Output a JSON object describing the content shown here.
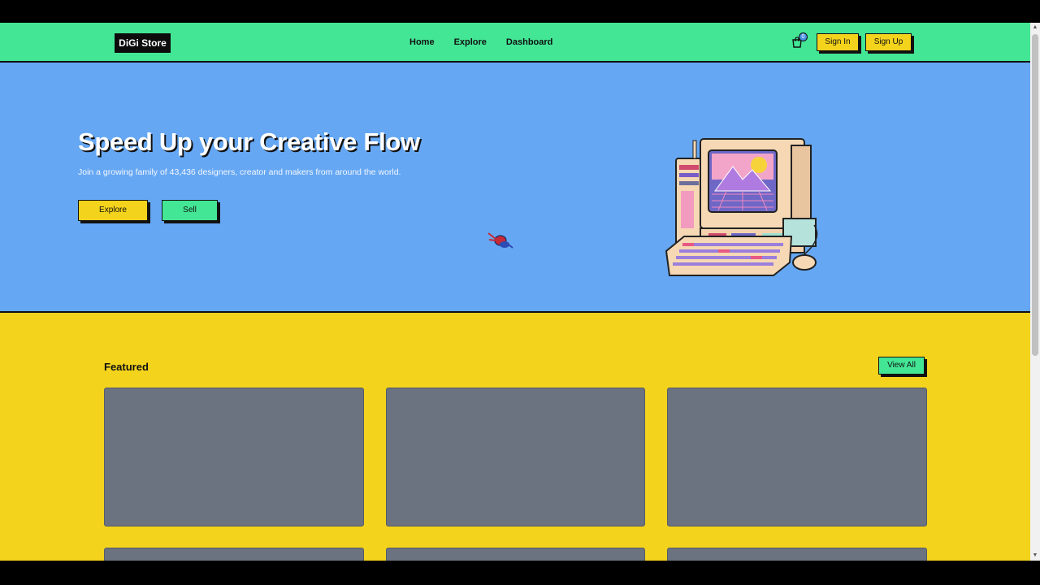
{
  "navbar": {
    "logo": "DiGi Store",
    "links": [
      "Home",
      "Explore",
      "Dashboard"
    ],
    "cart_count": "0",
    "sign_in": "Sign In",
    "sign_up": "Sign Up"
  },
  "hero": {
    "title": "Speed Up your Creative Flow",
    "subtitle": "Join a growing family of 43,436 designers, creator and makers from around the world.",
    "explore_button": "Explore",
    "sell_button": "Sell"
  },
  "featured": {
    "title": "Featured",
    "view_all": "View All"
  },
  "colors": {
    "navbar": "#43e695",
    "hero": "#65a7f3",
    "section": "#f4d31c",
    "card": "#6b7280"
  }
}
